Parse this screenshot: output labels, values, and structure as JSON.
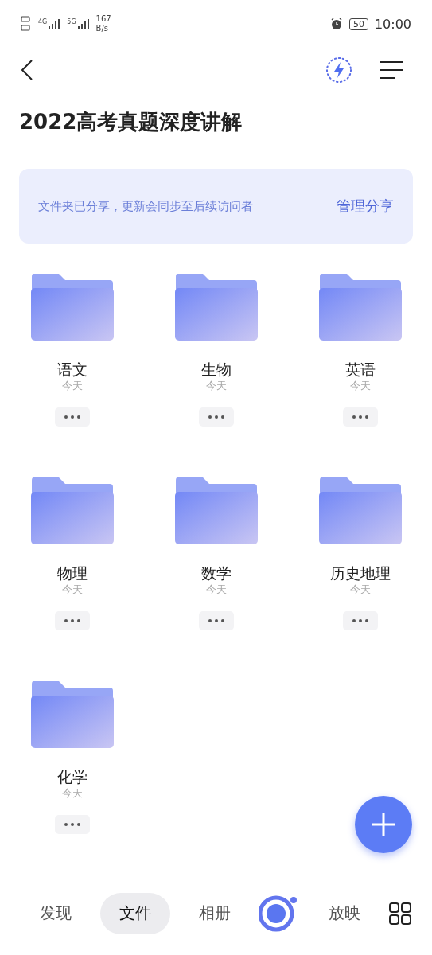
{
  "status_bar": {
    "net_labels": [
      "4G",
      "5G"
    ],
    "speed": "167",
    "speed_unit": "B/s",
    "battery": "50",
    "time": "10:00"
  },
  "title": "2022高考真题深度讲解",
  "share_banner": {
    "text": "文件夹已分享，更新会同步至后续访问者",
    "action": "管理分享"
  },
  "folders": [
    {
      "name": "语文",
      "date": "今天"
    },
    {
      "name": "生物",
      "date": "今天"
    },
    {
      "name": "英语",
      "date": "今天"
    },
    {
      "name": "物理",
      "date": "今天"
    },
    {
      "name": "数学",
      "date": "今天"
    },
    {
      "name": "历史地理",
      "date": "今天"
    },
    {
      "name": "化学",
      "date": "今天"
    }
  ],
  "bottom_nav": [
    {
      "kind": "tab",
      "label": "发现",
      "selected": false
    },
    {
      "kind": "tab",
      "label": "文件",
      "selected": true
    },
    {
      "kind": "tab",
      "label": "相册",
      "selected": false
    },
    {
      "kind": "logo"
    },
    {
      "kind": "tab",
      "label": "放映",
      "selected": false
    },
    {
      "kind": "grid"
    }
  ]
}
